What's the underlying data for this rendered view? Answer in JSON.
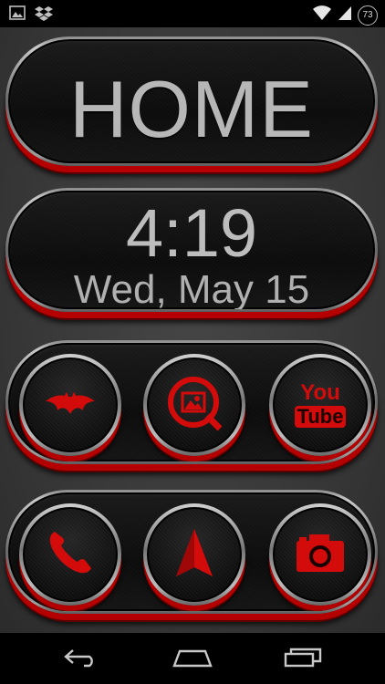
{
  "status_bar": {
    "left_icons": [
      "image-icon",
      "dropbox-icon"
    ],
    "right_icons": [
      "wifi-icon",
      "signal-icon"
    ],
    "battery_level": "73"
  },
  "home_widget": {
    "label": "HOME"
  },
  "clock_widget": {
    "time": "4:19",
    "date": "Wed, May 15"
  },
  "apps_row_1": [
    {
      "name": "batman-icon"
    },
    {
      "name": "quickpic-gallery-icon"
    },
    {
      "name": "youtube-icon",
      "logo_text_top": "You",
      "logo_text_bottom": "Tube"
    }
  ],
  "apps_row_2": [
    {
      "name": "phone-icon"
    },
    {
      "name": "navigation-icon"
    },
    {
      "name": "camera-icon"
    }
  ],
  "nav_bar": {
    "icons": [
      "back-icon",
      "home-icon",
      "recents-icon"
    ]
  },
  "colors": {
    "accent": "#d40b0b",
    "text": "#b7b7b7",
    "background": "#3a3a3a"
  }
}
